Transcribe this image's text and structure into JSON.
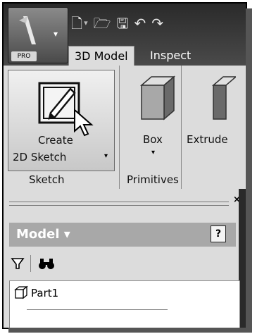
{
  "app": {
    "edition_tag": "PRO"
  },
  "quick_access": {
    "icons": [
      "new-file-icon",
      "dropdown-caret-icon",
      "open-folder-icon",
      "save-icon",
      "undo-icon",
      "redo-icon"
    ]
  },
  "tabs": [
    {
      "label": "3D Model",
      "active": true
    },
    {
      "label": "Inspect",
      "active": false
    }
  ],
  "ribbon": {
    "sketch_panel": {
      "button_line1": "Create",
      "button_line2": "2D Sketch",
      "panel_label": "Sketch"
    },
    "primitives_panel": {
      "button_label": "Box",
      "panel_label": "Primitives"
    },
    "create_panel": {
      "button_label": "Extrude"
    }
  },
  "browser": {
    "title": "Model ▾",
    "help": "?",
    "close": "×",
    "tree": [
      {
        "label": "Part1"
      }
    ]
  }
}
